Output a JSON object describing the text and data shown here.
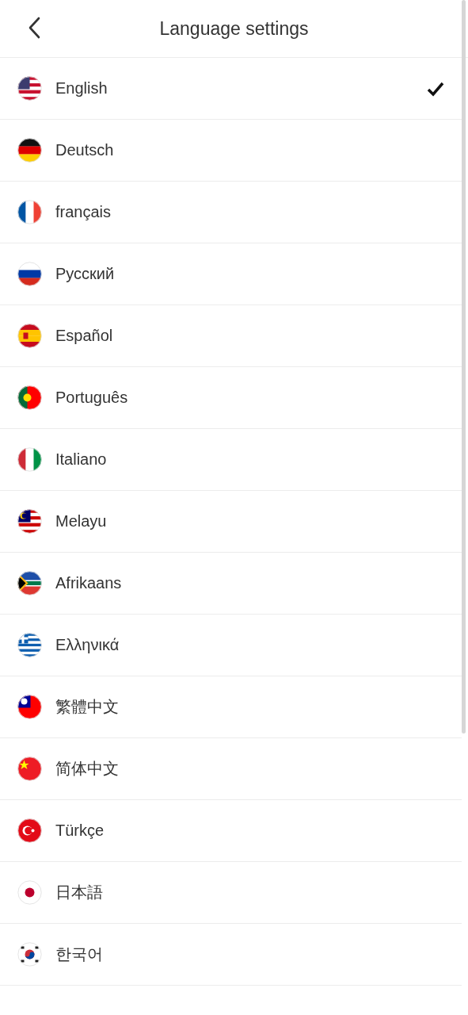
{
  "header": {
    "title": "Language settings"
  },
  "languages": [
    {
      "name": "English",
      "selected": true
    },
    {
      "name": "Deutsch",
      "selected": false
    },
    {
      "name": "français",
      "selected": false
    },
    {
      "name": "Русский",
      "selected": false
    },
    {
      "name": "Español",
      "selected": false
    },
    {
      "name": "Português",
      "selected": false
    },
    {
      "name": "Italiano",
      "selected": false
    },
    {
      "name": "Melayu",
      "selected": false
    },
    {
      "name": "Afrikaans",
      "selected": false
    },
    {
      "name": "Ελληνικά",
      "selected": false
    },
    {
      "name": "繁體中文",
      "selected": false
    },
    {
      "name": "简体中文",
      "selected": false
    },
    {
      "name": "Türkçe",
      "selected": false
    },
    {
      "name": "日本語",
      "selected": false
    },
    {
      "name": "한국어",
      "selected": false
    }
  ]
}
